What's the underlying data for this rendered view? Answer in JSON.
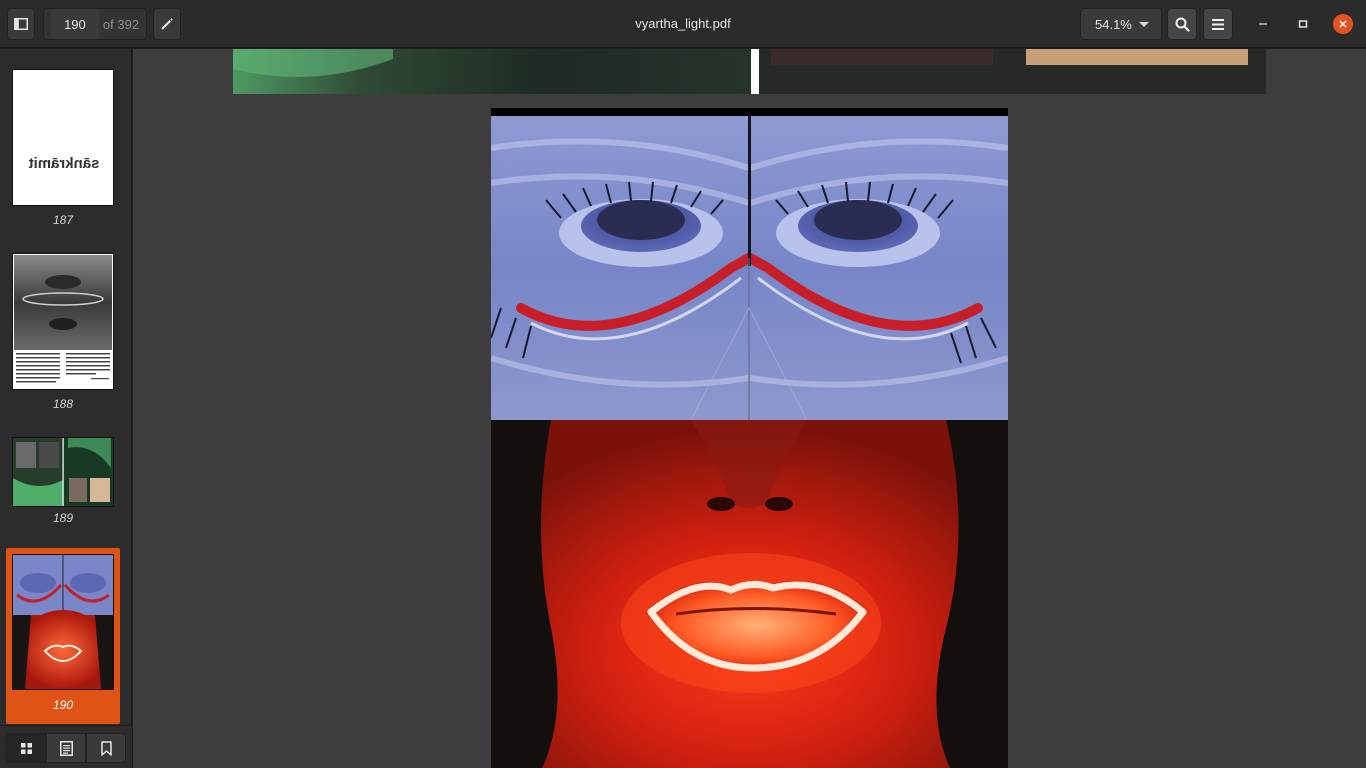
{
  "header": {
    "page_current": "190",
    "page_total": "of 392",
    "doc_title": "vyartha_light.pdf",
    "zoom_level": "54.1%"
  },
  "icons": {
    "sidebar_toggle": "sidebar-icon",
    "annotate": "pencil-icon",
    "zoom_dropdown": "chevron-down-icon",
    "search": "search-icon",
    "menu": "hamburger-icon",
    "minimize": "minimize-icon",
    "maximize": "maximize-icon",
    "close": "close-icon",
    "thumbnails_view": "grid-icon",
    "outline_view": "document-list-icon",
    "bookmarks_view": "bookmark-icon"
  },
  "sidebar": {
    "thumbnails": [
      {
        "page": "187",
        "title_text": "sānkrāmit"
      },
      {
        "page": "188"
      },
      {
        "page": "189"
      },
      {
        "page": "190",
        "selected": true
      }
    ]
  },
  "colors": {
    "accent": "#e05316",
    "header_bg": "#2b2b2b",
    "viewer_bg": "#3d3d3d",
    "sidebar_bg": "#2c2c2c"
  }
}
